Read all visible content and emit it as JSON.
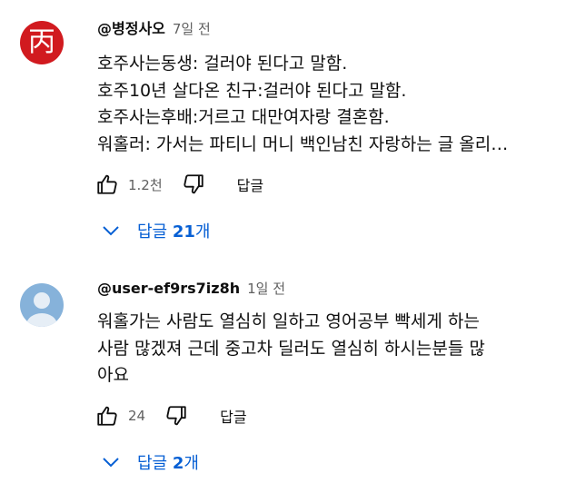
{
  "comments": [
    {
      "author": "@병정사오",
      "time": "7일 전",
      "avatar_glyph": "丙",
      "lines": [
        "호주사는동생: 걸러야 된다고 말함.",
        "호주10년 살다온 친구:걸러야 된다고 말함.",
        "호주사는후배:거르고 대만여자랑 결혼함.",
        "워홀러: 가서는 파티니 머니 백인남친 자랑하는 글 올리…"
      ],
      "likes": "1.2천",
      "reply_label": "답글",
      "replies_prefix": "답글 ",
      "replies_count": "21",
      "replies_suffix": "개"
    },
    {
      "author": "@user-ef9rs7iz8h",
      "time": "1일 전",
      "lines": [
        "워홀가는 사람도 열심히 일하고 영어공부 빡세게 하는",
        "사람 많겠져 근데 중고차 딜러도 열심히 하시는분들 많",
        "아요"
      ],
      "likes": "24",
      "reply_label": "답글",
      "replies_prefix": "답글 ",
      "replies_count": "2",
      "replies_suffix": "개"
    }
  ],
  "icons": {
    "like": "thumbs-up-icon",
    "dislike": "thumbs-down-icon",
    "expand": "chevron-down-icon"
  },
  "colors": {
    "link_blue": "#065fd4",
    "avatar_red": "#d11a1f",
    "avatar_blue": "#86b2da",
    "secondary_text": "#606060"
  }
}
